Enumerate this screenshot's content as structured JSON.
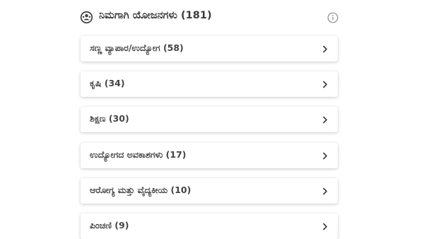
{
  "section": {
    "title": "ನಿಮಗಾಗಿ ಯೋಜನಗಳು (181)",
    "icon": "people-circle-icon",
    "info_icon": "info-icon"
  },
  "colors": {
    "icon_stroke": "#3f3f3f",
    "info_stroke": "#8a8a8a",
    "chevron": "#3a3a3a"
  },
  "categories": [
    {
      "label": "ಸಣ್ಣ ವ್ಯಾಪಾರ/ಉದ್ಯೋಗ (58)"
    },
    {
      "label": "ಕೃಷಿ (34)"
    },
    {
      "label": "ಶಿಕ್ಷಣ (30)"
    },
    {
      "label": "ಉದ್ಯೋಗದ ಅವಕಾಶಗಳು (17)"
    },
    {
      "label": "ಆರೋಗ್ಯ ಮತ್ತು ವೈದ್ಯಕೀಯ (10)"
    },
    {
      "label": "ಪಿಂಚಣಿ (9)"
    }
  ]
}
